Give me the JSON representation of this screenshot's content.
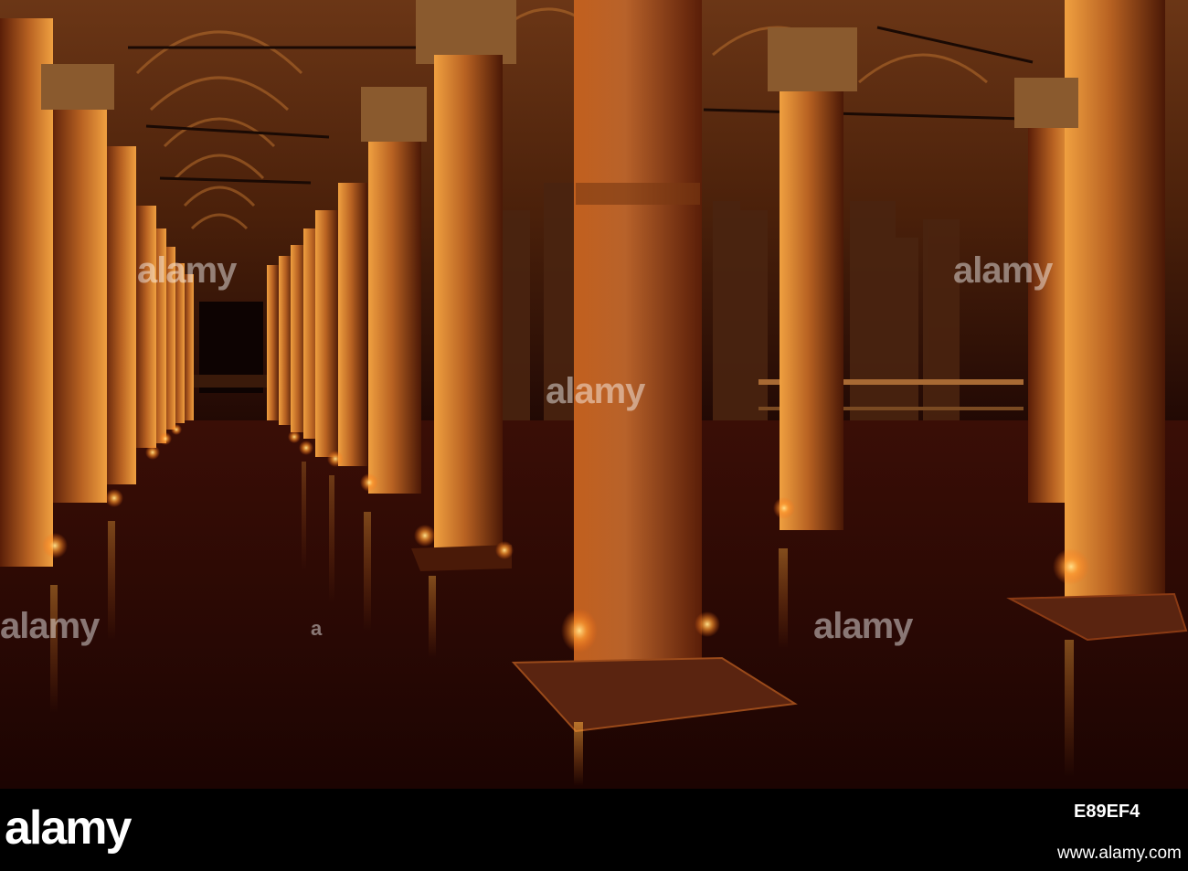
{
  "watermark": {
    "text": "alamy",
    "small_mark": "a"
  },
  "footer": {
    "logo": "alamy",
    "image_code": "E89EF4",
    "url": "www.alamy.com"
  },
  "colors": {
    "background": "#000000",
    "vault": "#5a2a10",
    "pillar_lit": "#e08a2a",
    "pillar_shadow": "#5a2008",
    "water": "#2a0804",
    "lamp": "#ffd060"
  }
}
